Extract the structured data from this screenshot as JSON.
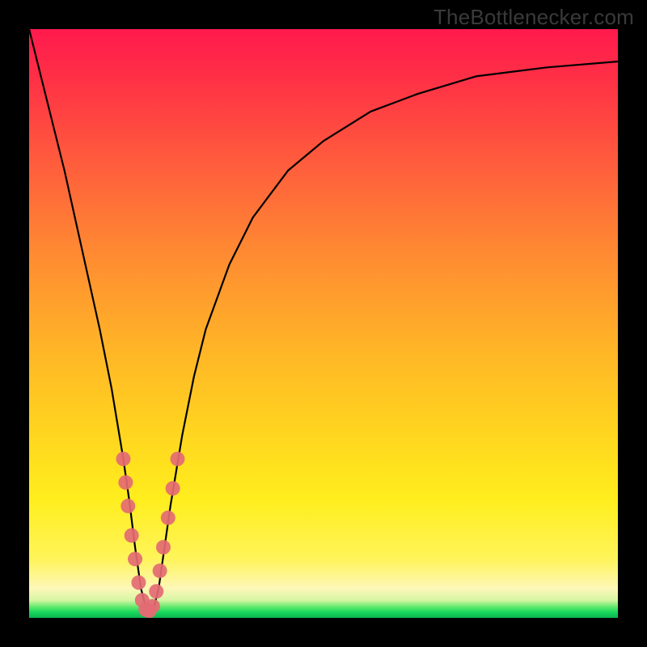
{
  "watermark": "TheBottlenecker.com",
  "chart_data": {
    "type": "line",
    "title": "",
    "xlabel": "",
    "ylabel": "",
    "xlim": [
      0,
      100
    ],
    "ylim": [
      0,
      100
    ],
    "series": [
      {
        "name": "bottleneck-curve",
        "x": [
          0,
          2,
          4,
          6,
          8,
          10,
          12,
          14,
          16,
          17,
          18,
          19,
          20,
          21,
          22,
          23,
          24,
          26,
          28,
          30,
          34,
          38,
          44,
          50,
          58,
          66,
          76,
          88,
          100
        ],
        "values": [
          100,
          92,
          84,
          76,
          67,
          58,
          49,
          39,
          27,
          20,
          12,
          5,
          1,
          1,
          5,
          12,
          19,
          31,
          41,
          49,
          60,
          68,
          76,
          81,
          86,
          89,
          92,
          93.5,
          94.5
        ]
      }
    ],
    "markers": {
      "name": "highlight-dots",
      "color": "#e46a73",
      "points": [
        {
          "x": 16.0,
          "y": 27
        },
        {
          "x": 16.4,
          "y": 23
        },
        {
          "x": 16.8,
          "y": 19
        },
        {
          "x": 17.4,
          "y": 14
        },
        {
          "x": 18.0,
          "y": 10
        },
        {
          "x": 18.6,
          "y": 6
        },
        {
          "x": 19.2,
          "y": 3
        },
        {
          "x": 19.8,
          "y": 1.4
        },
        {
          "x": 20.4,
          "y": 1.2
        },
        {
          "x": 21.0,
          "y": 2
        },
        {
          "x": 21.6,
          "y": 4.5
        },
        {
          "x": 22.2,
          "y": 8
        },
        {
          "x": 22.8,
          "y": 12
        },
        {
          "x": 23.6,
          "y": 17
        },
        {
          "x": 24.4,
          "y": 22
        },
        {
          "x": 25.2,
          "y": 27
        }
      ]
    },
    "gradient_stops": [
      {
        "pos": 0,
        "color": "#ff1a4d"
      },
      {
        "pos": 0.5,
        "color": "#ffc020"
      },
      {
        "pos": 0.85,
        "color": "#fff030"
      },
      {
        "pos": 0.97,
        "color": "#e0f7a0"
      },
      {
        "pos": 1.0,
        "color": "#0bb34e"
      }
    ]
  }
}
